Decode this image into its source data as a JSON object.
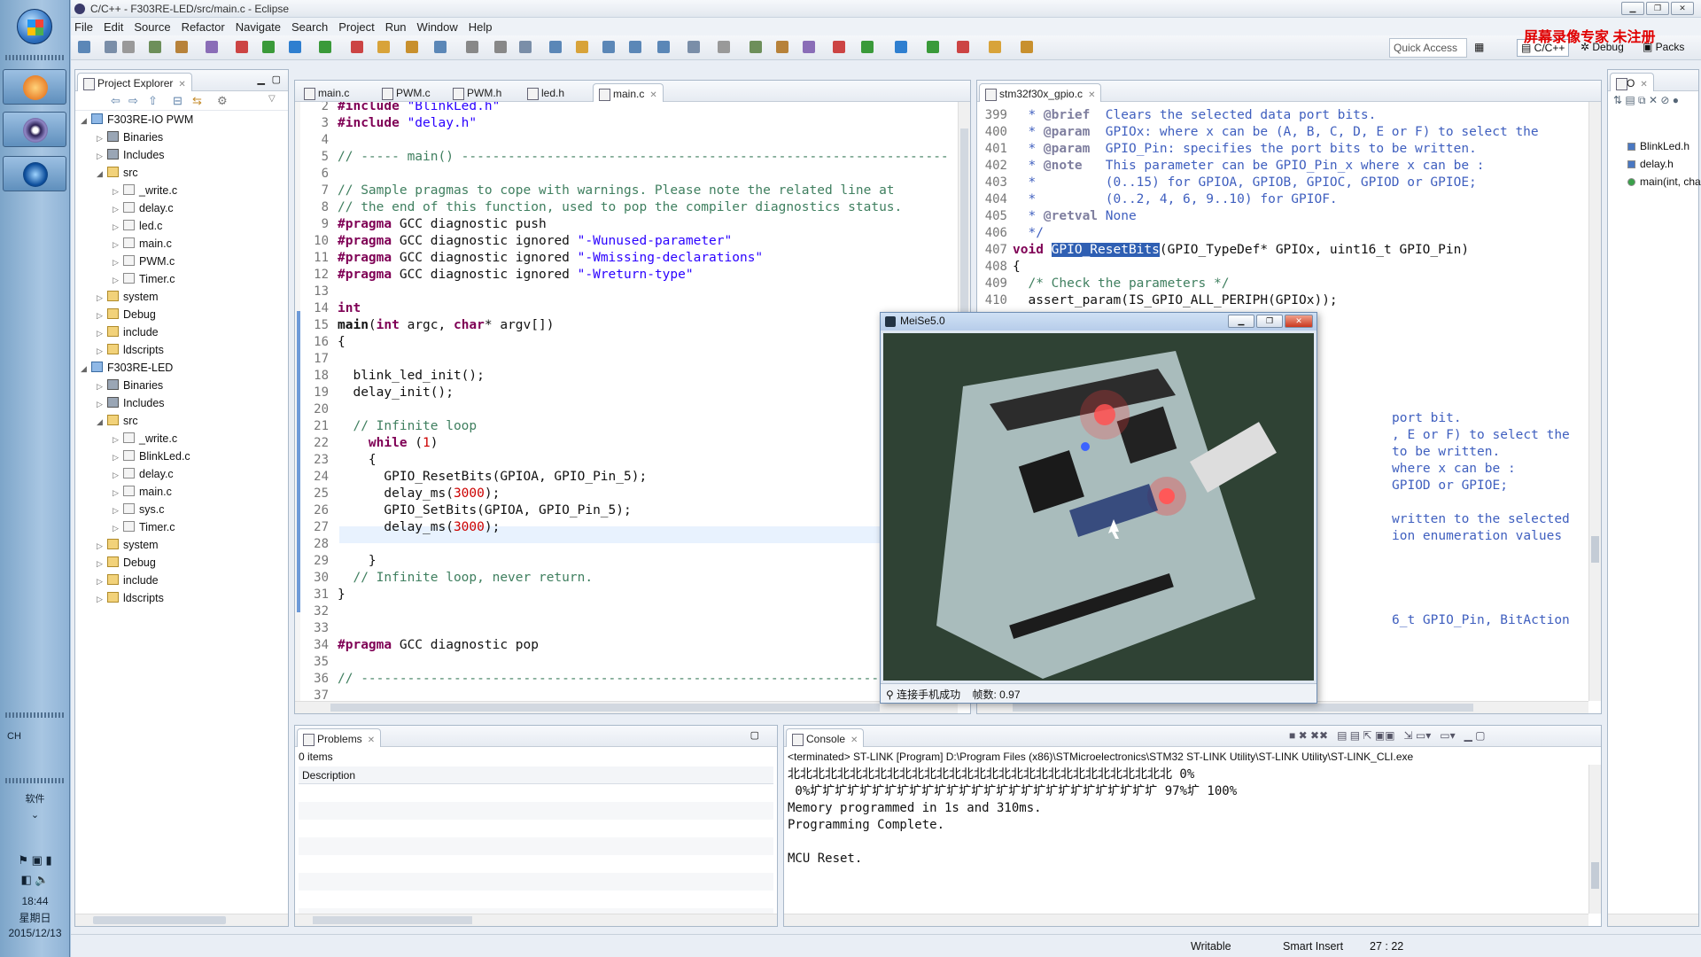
{
  "window": {
    "title": "C/C++ - F303RE-LED/src/main.c - Eclipse"
  },
  "menu": [
    "File",
    "Edit",
    "Source",
    "Refactor",
    "Navigate",
    "Search",
    "Project",
    "Run",
    "Window",
    "Help"
  ],
  "toolbar": {
    "quick_access": "Quick Access",
    "perspectives": [
      "C/C++",
      "Debug",
      "Packs"
    ],
    "watermark": "屏幕录像专家  未注册"
  },
  "project_explorer": {
    "title": "Project Explorer",
    "tree": [
      {
        "label": "F303RE-IO PWM",
        "depth": 0,
        "kind": "proj",
        "expanded": true
      },
      {
        "label": "Binaries",
        "depth": 1,
        "kind": "bin"
      },
      {
        "label": "Includes",
        "depth": 1,
        "kind": "bin"
      },
      {
        "label": "src",
        "depth": 1,
        "kind": "folder",
        "expanded": true
      },
      {
        "label": "_write.c",
        "depth": 2,
        "kind": "file"
      },
      {
        "label": "delay.c",
        "depth": 2,
        "kind": "file"
      },
      {
        "label": "led.c",
        "depth": 2,
        "kind": "file"
      },
      {
        "label": "main.c",
        "depth": 2,
        "kind": "file"
      },
      {
        "label": "PWM.c",
        "depth": 2,
        "kind": "file"
      },
      {
        "label": "Timer.c",
        "depth": 2,
        "kind": "file"
      },
      {
        "label": "system",
        "depth": 1,
        "kind": "folder"
      },
      {
        "label": "Debug",
        "depth": 1,
        "kind": "folder"
      },
      {
        "label": "include",
        "depth": 1,
        "kind": "folder"
      },
      {
        "label": "ldscripts",
        "depth": 1,
        "kind": "folder"
      },
      {
        "label": "F303RE-LED",
        "depth": 0,
        "kind": "proj",
        "expanded": true
      },
      {
        "label": "Binaries",
        "depth": 1,
        "kind": "bin"
      },
      {
        "label": "Includes",
        "depth": 1,
        "kind": "bin"
      },
      {
        "label": "src",
        "depth": 1,
        "kind": "folder",
        "expanded": true
      },
      {
        "label": "_write.c",
        "depth": 2,
        "kind": "file"
      },
      {
        "label": "BlinkLed.c",
        "depth": 2,
        "kind": "file"
      },
      {
        "label": "delay.c",
        "depth": 2,
        "kind": "file"
      },
      {
        "label": "main.c",
        "depth": 2,
        "kind": "file"
      },
      {
        "label": "sys.c",
        "depth": 2,
        "kind": "file"
      },
      {
        "label": "Timer.c",
        "depth": 2,
        "kind": "file"
      },
      {
        "label": "system",
        "depth": 1,
        "kind": "folder"
      },
      {
        "label": "Debug",
        "depth": 1,
        "kind": "folder"
      },
      {
        "label": "include",
        "depth": 1,
        "kind": "folder"
      },
      {
        "label": "ldscripts",
        "depth": 1,
        "kind": "folder"
      }
    ]
  },
  "editor_left": {
    "tabs": [
      "main.c",
      "PWM.c",
      "PWM.h",
      "led.h",
      "main.c"
    ],
    "active_tab": 4,
    "lines": [
      {
        "n": "2",
        "segs": [
          [
            "pp",
            "#include "
          ],
          [
            "str",
            "\"BlinkLed.h\""
          ]
        ]
      },
      {
        "n": "3",
        "segs": [
          [
            "pp",
            "#include "
          ],
          [
            "str",
            "\"delay.h\""
          ]
        ]
      },
      {
        "n": "4",
        "segs": []
      },
      {
        "n": "5",
        "segs": [
          [
            "cm",
            "// ----- main() ---------------------------------------------------------------"
          ]
        ]
      },
      {
        "n": "6",
        "segs": []
      },
      {
        "n": "7",
        "segs": [
          [
            "cm",
            "// Sample pragmas to cope with warnings. Please note the related line at"
          ]
        ]
      },
      {
        "n": "8",
        "segs": [
          [
            "cm",
            "// the end of this function, used to pop the compiler diagnostics status."
          ]
        ]
      },
      {
        "n": "9",
        "segs": [
          [
            "pp",
            "#pragma "
          ],
          [
            "",
            "GCC diagnostic push"
          ]
        ]
      },
      {
        "n": "10",
        "segs": [
          [
            "pp",
            "#pragma "
          ],
          [
            "",
            "GCC diagnostic ignored "
          ],
          [
            "str",
            "\"-Wunused-parameter\""
          ]
        ]
      },
      {
        "n": "11",
        "segs": [
          [
            "pp",
            "#pragma "
          ],
          [
            "",
            "GCC diagnostic ignored "
          ],
          [
            "str",
            "\"-Wmissing-declarations\""
          ]
        ]
      },
      {
        "n": "12",
        "segs": [
          [
            "pp",
            "#pragma "
          ],
          [
            "",
            "GCC diagnostic ignored "
          ],
          [
            "str",
            "\"-Wreturn-type\""
          ]
        ]
      },
      {
        "n": "13",
        "segs": []
      },
      {
        "n": "14",
        "segs": [
          [
            "kw",
            "int"
          ]
        ]
      },
      {
        "n": "15",
        "segs": [
          [
            "b",
            "main"
          ],
          [
            "",
            "("
          ],
          [
            "kw",
            "int"
          ],
          [
            "",
            " argc, "
          ],
          [
            "kw",
            "char"
          ],
          [
            "",
            "* argv[])"
          ]
        ]
      },
      {
        "n": "16",
        "segs": [
          [
            "",
            "{"
          ]
        ]
      },
      {
        "n": "17",
        "segs": []
      },
      {
        "n": "18",
        "segs": [
          [
            "",
            "  blink_led_init();"
          ]
        ]
      },
      {
        "n": "19",
        "segs": [
          [
            "",
            "  delay_init();"
          ]
        ]
      },
      {
        "n": "20",
        "segs": []
      },
      {
        "n": "21",
        "segs": [
          [
            "cm",
            "  // Infinite loop"
          ]
        ]
      },
      {
        "n": "22",
        "segs": [
          [
            "kw",
            "    while"
          ],
          [
            "",
            " ("
          ],
          [
            "num",
            "1"
          ],
          [
            "",
            ")"
          ]
        ]
      },
      {
        "n": "23",
        "segs": [
          [
            "",
            "    {"
          ]
        ]
      },
      {
        "n": "24",
        "segs": [
          [
            "",
            "      GPIO_ResetBits(GPIOA, GPIO_Pin_5);"
          ]
        ]
      },
      {
        "n": "25",
        "segs": [
          [
            "",
            "      delay_ms("
          ],
          [
            "num",
            "3000"
          ],
          [
            "",
            ");"
          ]
        ]
      },
      {
        "n": "26",
        "segs": [
          [
            "",
            "      GPIO_SetBits(GPIOA, GPIO_Pin_5);"
          ]
        ]
      },
      {
        "n": "27",
        "segs": [
          [
            "",
            "      delay_ms("
          ],
          [
            "num",
            "3000"
          ],
          [
            "",
            ");"
          ]
        ]
      },
      {
        "n": "28",
        "segs": []
      },
      {
        "n": "29",
        "segs": [
          [
            "",
            "    }"
          ]
        ]
      },
      {
        "n": "30",
        "segs": [
          [
            "cm",
            "  // Infinite loop, never return."
          ]
        ]
      },
      {
        "n": "31",
        "segs": [
          [
            "",
            "}"
          ]
        ]
      },
      {
        "n": "32",
        "segs": []
      },
      {
        "n": "33",
        "segs": []
      },
      {
        "n": "34",
        "segs": [
          [
            "pp",
            "#pragma "
          ],
          [
            "",
            "GCC diagnostic pop"
          ]
        ]
      },
      {
        "n": "35",
        "segs": []
      },
      {
        "n": "36",
        "segs": [
          [
            "cm",
            "// ----------------------------------------------------------------------------"
          ]
        ]
      },
      {
        "n": "37",
        "segs": []
      }
    ]
  },
  "editor_right": {
    "tab": "stm32f30x_gpio.c",
    "lines": [
      {
        "n": "399",
        "segs": [
          [
            "jd",
            "  * "
          ],
          [
            "jtag",
            "@brief"
          ],
          [
            "jd",
            "  Clears the selected data port bits."
          ]
        ]
      },
      {
        "n": "400",
        "segs": [
          [
            "jd",
            "  * "
          ],
          [
            "jtag",
            "@param"
          ],
          [
            "jd",
            "  GPIOx: where x can be (A, B, C, D, E or F) to select the"
          ]
        ]
      },
      {
        "n": "401",
        "segs": [
          [
            "jd",
            "  * "
          ],
          [
            "jtag",
            "@param"
          ],
          [
            "jd",
            "  GPIO_Pin: specifies the port bits to be written."
          ]
        ]
      },
      {
        "n": "402",
        "segs": [
          [
            "jd",
            "  * "
          ],
          [
            "jtag",
            "@note"
          ],
          [
            "jd",
            "   This parameter can be GPIO_Pin_x where x can be :"
          ]
        ]
      },
      {
        "n": "403",
        "segs": [
          [
            "jd",
            "  *         (0..15) for GPIOA, GPIOB, GPIOC, GPIOD or GPIOE;"
          ]
        ]
      },
      {
        "n": "404",
        "segs": [
          [
            "jd",
            "  *         (0..2, 4, 6, 9..10) for GPIOF."
          ]
        ]
      },
      {
        "n": "405",
        "segs": [
          [
            "jd",
            "  * "
          ],
          [
            "jtag",
            "@retval"
          ],
          [
            "jd",
            " None"
          ]
        ]
      },
      {
        "n": "406",
        "segs": [
          [
            "jd",
            "  */"
          ]
        ]
      },
      {
        "n": "407",
        "segs": [
          [
            "kw",
            "void "
          ],
          [
            "hl",
            "GPIO_ResetBits"
          ],
          [
            "",
            "(GPIO_TypeDef* GPIOx, uint16_t GPIO_Pin)"
          ]
        ]
      },
      {
        "n": "408",
        "segs": [
          [
            "",
            "{"
          ]
        ]
      },
      {
        "n": "409",
        "segs": [
          [
            "cm",
            "  /* Check the parameters */"
          ]
        ]
      },
      {
        "n": "410",
        "segs": [
          [
            "",
            "  assert_param(IS_GPIO_ALL_PERIPH(GPIOx));"
          ]
        ]
      }
    ],
    "partial_lines": [
      {
        "row": 18,
        "text": "port bit."
      },
      {
        "row": 19,
        "text": ", E or F) to select the"
      },
      {
        "row": 20,
        "text": "to be written."
      },
      {
        "row": 21,
        "text": "where x can be :"
      },
      {
        "row": 22,
        "text": "GPIOD or GPIOE;"
      },
      {
        "row": 24,
        "text": "written to the selected"
      },
      {
        "row": 25,
        "text": "ion enumeration values"
      },
      {
        "row": 30,
        "text": "6_t GPIO_Pin, BitAction"
      }
    ]
  },
  "outline": {
    "items": [
      "BlinkLed.h",
      "delay.h",
      "main(int, char*[])"
    ]
  },
  "problems": {
    "title": "Problems",
    "count": "0 items",
    "column": "Description"
  },
  "console": {
    "title": "Console",
    "header": "<terminated> ST-LINK [Program] D:\\Program Files (x86)\\STMicroelectronics\\STM32 ST-LINK Utility\\ST-LINK Utility\\ST-LINK_CLI.exe",
    "lines": [
      "北北北北北北北北北北北北北北北北北北北北北北北北北北北北北北北 0%",
      " 0%圹圹圹圹圹圹圹圹圹圹圹圹圹圹圹圹圹圹圹圹圹圹圹圹圹圹圹圹 97%圹 100%",
      "Memory programmed in 1s and 310ms.",
      "Programming Complete.",
      "",
      "MCU Reset."
    ]
  },
  "meise": {
    "title": "MeiSe5.0",
    "status": "连接手机成功",
    "fps": "帧数: 0.97"
  },
  "status": {
    "writable": "Writable",
    "insert": "Smart Insert",
    "pos": "27 : 22"
  },
  "taskbar": {
    "lang": "CH",
    "label": "软件",
    "time": "18:44",
    "weekday": "星期日",
    "date": "2015/12/13"
  }
}
